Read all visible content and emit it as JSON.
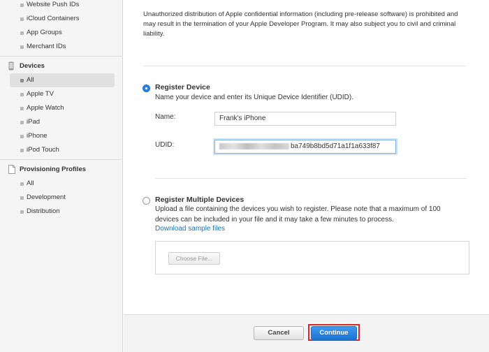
{
  "sidebar": {
    "top_items": [
      {
        "label": "Website Push IDs"
      },
      {
        "label": "iCloud Containers"
      },
      {
        "label": "App Groups"
      },
      {
        "label": "Merchant IDs"
      }
    ],
    "devices": {
      "heading": "Devices",
      "icon": "iphone-icon",
      "items": [
        {
          "label": "All",
          "selected": true
        },
        {
          "label": "Apple TV"
        },
        {
          "label": "Apple Watch"
        },
        {
          "label": "iPad"
        },
        {
          "label": "iPhone"
        },
        {
          "label": "iPod Touch"
        }
      ]
    },
    "profiles": {
      "heading": "Provisioning Profiles",
      "icon": "document-icon",
      "items": [
        {
          "label": "All"
        },
        {
          "label": "Development"
        },
        {
          "label": "Distribution"
        }
      ]
    }
  },
  "main": {
    "notice": "Unauthorized distribution of Apple confidential information (including pre-release software) is prohibited and may result in the termination of your Apple Developer Program. It may also subject you to civil and criminal liability.",
    "register_device": {
      "title": "Register Device",
      "description": "Name your device and enter its Unique Device Identifier (UDID).",
      "selected": true,
      "name_label": "Name:",
      "name_value": "Frank's iPhone",
      "udid_label": "UDID:",
      "udid_value_visible": "ba749b8bd5d71a1f1a633f87"
    },
    "register_multiple": {
      "title": "Register Multiple Devices",
      "description": "Upload a file containing the devices you wish to register. Please note that a maximum of 100 devices can be included in your file and it may take a few minutes to process.",
      "link": "Download sample files",
      "choose_file": "Choose File..."
    }
  },
  "footer": {
    "cancel": "Cancel",
    "continue": "Continue"
  },
  "colors": {
    "accent": "#2a84e8",
    "link": "#0d76c4",
    "highlight_border": "#d02a2a"
  }
}
